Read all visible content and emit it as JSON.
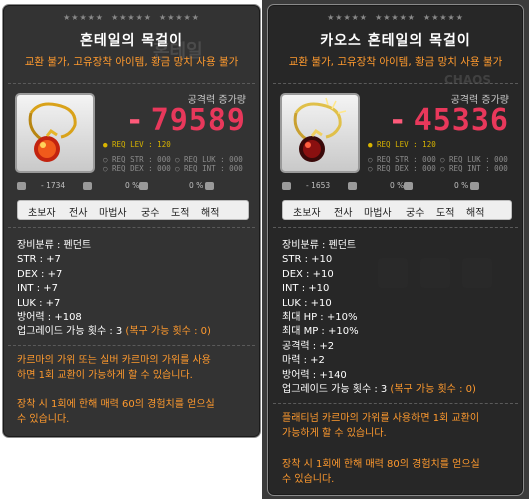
{
  "left": {
    "name": "혼테일의 목걸이",
    "ghost": "혼테일",
    "tradable": "교환 불가, 고유장착 아이템, 황금 망치 사용 불가",
    "attack_label": "공격력 증가량",
    "attack_value": "79589",
    "req": {
      "lev": "● REQ LEV : 120",
      "str": "○ REQ STR : 000",
      "luk": "○ REQ LUK : 000",
      "dex": "○ REQ DEX : 000",
      "int": "○ REQ INT : 000"
    },
    "mini": {
      "a": "- 1734",
      "b": "0 %",
      "c": "0 %"
    },
    "jobs": [
      "초보자",
      "전사",
      "마법사",
      "궁수",
      "도적",
      "해적"
    ],
    "stats": [
      "장비분류 : 펜던트",
      "STR : +7",
      "DEX : +7",
      "INT : +7",
      "LUK : +7",
      "방어력 : +108"
    ],
    "upgrade": "업그레이드 가능 횟수 : 3",
    "upgrade_extra": " (복구 가능 횟수 : 0)",
    "note1": "카르마의 가위 또는 실버 카르마의 가위를 사용\n하면 1회 교환이 가능하게 할 수 있습니다.",
    "note2": "장착 시 1회에 한해 매력 60의 경험치를 얻으실\n수 있습니다."
  },
  "right": {
    "name": "카오스 혼테일의 목걸이",
    "ghost": "CHAOS",
    "tradable": "교환 불가, 고유장착 아이템, 황금 망치 사용 불가",
    "attack_label": "공격력 증가량",
    "attack_value": "45336",
    "req": {
      "lev": "● REQ LEV : 120",
      "str": "○ REQ STR : 000",
      "luk": "○ REQ LUK : 000",
      "dex": "○ REQ DEX : 000",
      "int": "○ REQ INT : 000"
    },
    "mini": {
      "a": "- 1653",
      "b": "0 %",
      "c": "0 %"
    },
    "jobs": [
      "초보자",
      "전사",
      "마법사",
      "궁수",
      "도적",
      "해적"
    ],
    "stats": [
      "장비분류 : 펜던트",
      "STR : +10",
      "DEX : +10",
      "INT : +10",
      "LUK : +10",
      "최대 HP : +10%",
      "최대 MP : +10%",
      "공격력 : +2",
      "마력 : +2",
      "방어력 : +140"
    ],
    "upgrade": "업그레이드 가능 횟수 : 3",
    "upgrade_extra": " (복구 가능 횟수 : 0)",
    "note1": "플래티넘 카르마의 가위를 사용하면 1회 교환이\n가능하게 할 수 있습니다.",
    "note2": "장착 시 1회에 한해 매력 80의 경험치를 얻으실\n수 있습니다."
  },
  "colors": {
    "attack": "#e8385b",
    "orange_text": "#ff9a2e",
    "req_lev": "#d8b400",
    "panel": "#262626"
  }
}
